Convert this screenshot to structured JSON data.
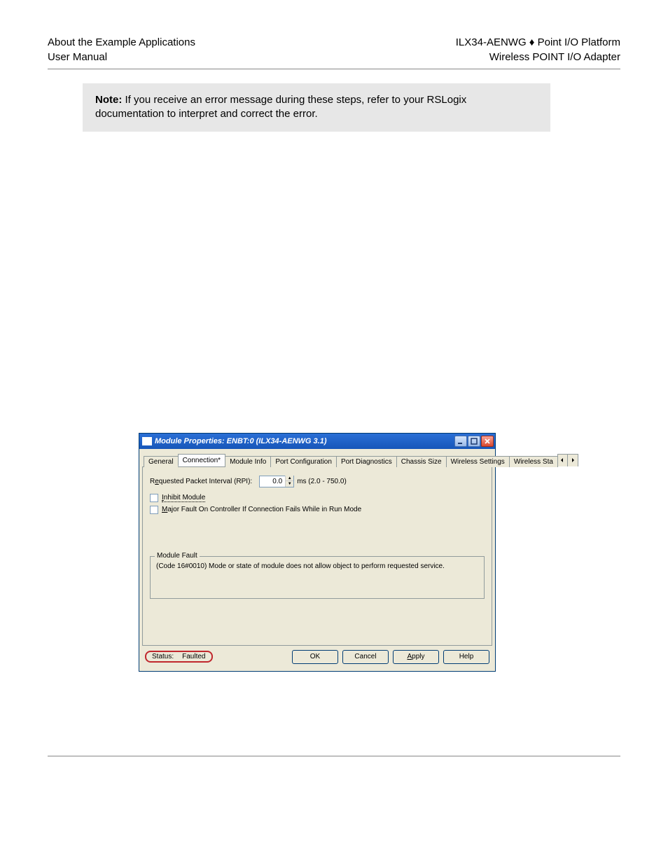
{
  "header": {
    "left1": "About the Example Applications",
    "left2": "User Manual",
    "right1_a": "ILX34-AENWG ",
    "right1_sym": "♦",
    "right1_b": " Point I/O Platform",
    "right2": "Wireless POINT I/O Adapter"
  },
  "note": {
    "label": "Note:",
    "text": " If you receive an error message during these steps, refer to your RSLogix documentation to interpret and correct the error."
  },
  "dialog": {
    "title": "Module Properties: ENBT:0 (ILX34-AENWG 3.1)",
    "tabs": [
      "General",
      "Connection*",
      "Module Info",
      "Port Configuration",
      "Port Diagnostics",
      "Chassis Size",
      "Wireless Settings",
      "Wireless Sta"
    ],
    "activeTabIndex": 1,
    "rpi": {
      "label_pre": "R",
      "label_u": "e",
      "label_post": "quested Packet Interval (RPI):",
      "value": "0.0",
      "range": "ms (2.0 - 750.0)"
    },
    "inhibit": {
      "pre": "",
      "u": "I",
      "post": "nhibit Module"
    },
    "fault": {
      "pre": "",
      "u": "M",
      "post": "ajor Fault On Controller If Connection Fails While in Run Mode"
    },
    "fieldset": {
      "legend": "Module Fault",
      "msg": "(Code 16#0010) Mode or state of module does not allow object to perform requested service."
    },
    "status": {
      "label": "Status:",
      "value": "Faulted"
    },
    "buttons": {
      "ok": "OK",
      "cancel": "Cancel",
      "apply": "Apply",
      "help": "Help",
      "apply_u": "A",
      "apply_post": "pply"
    }
  }
}
